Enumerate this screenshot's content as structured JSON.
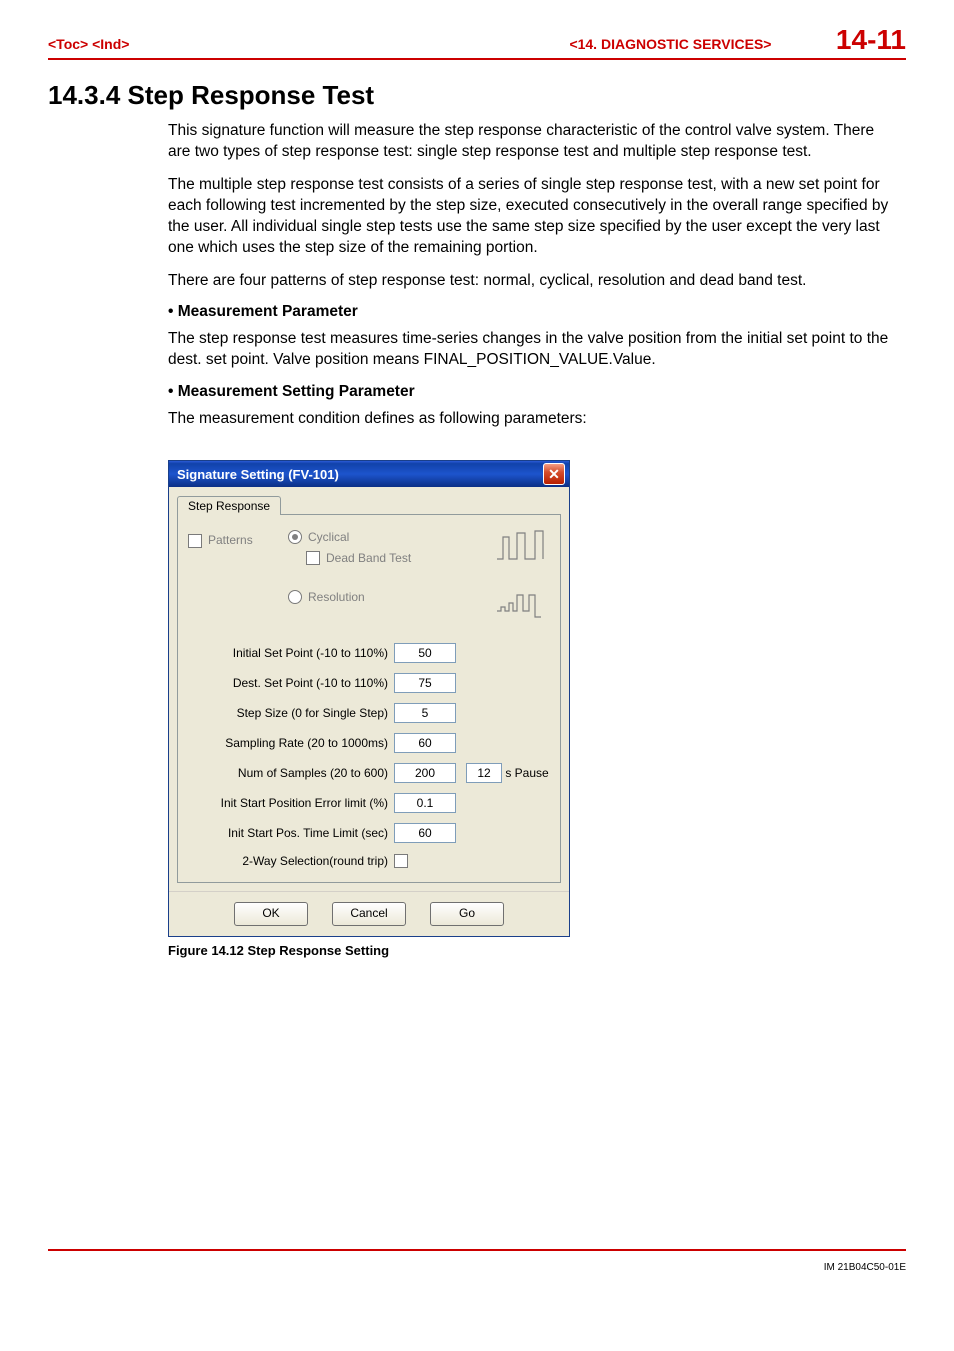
{
  "header": {
    "left": "<Toc> <Ind>",
    "chapter": "<14.  DIAGNOSTIC SERVICES>",
    "page": "14-11"
  },
  "section": {
    "number_title": "14.3.4  Step Response Test"
  },
  "paragraphs": {
    "p1": "This signature function will measure the step response characteristic of the control valve system. There are two types of step response test: single step response test and multiple step response test.",
    "p2": "The multiple step response test consists of a series of single step response test, with a new set point for each following test incremented by the step size, executed consecutively in the overall range specified by the user. All individual single step tests use the same step size specified by the user except the very last one which uses the step size of the remaining portion.",
    "p3": "There are four patterns of step response test: normal, cyclical, resolution and dead band test.",
    "bullet1": "Measurement Parameter",
    "p4": "The step response test measures time-series changes in the valve position from the initial set point to the dest. set point. Valve position means FINAL_POSITION_VALUE.Value.",
    "bullet2": "Measurement Setting Parameter",
    "p5": "The measurement condition defines as following parameters:"
  },
  "dialog": {
    "title": "Signature Setting (FV-101)",
    "tab": "Step Response",
    "patterns_label": "Patterns",
    "cyclical": "Cyclical",
    "dead_band": "Dead Band Test",
    "resolution": "Resolution",
    "fields": {
      "initial_set_point": {
        "label": "Initial Set Point (-10 to 110%)",
        "value": "50"
      },
      "dest_set_point": {
        "label": "Dest. Set Point (-10 to 110%)",
        "value": "75"
      },
      "step_size": {
        "label": "Step Size (0 for Single Step)",
        "value": "5"
      },
      "sampling_rate": {
        "label": "Sampling Rate (20 to 1000ms)",
        "value": "60"
      },
      "num_samples": {
        "label": "Num of Samples (20 to 600)",
        "value": "200",
        "pause_value": "12",
        "pause_suffix": "s  Pause"
      },
      "init_err_limit": {
        "label": "Init Start Position Error limit (%)",
        "value": "0.1"
      },
      "init_time_limit": {
        "label": "Init Start Pos. Time Limit (sec)",
        "value": "60"
      },
      "two_way": {
        "label": "2-Way Selection(round trip)"
      }
    },
    "buttons": {
      "ok": "OK",
      "cancel": "Cancel",
      "go": "Go"
    }
  },
  "figure_caption": "Figure 14.12  Step Response Setting",
  "footer_id": "IM 21B04C50-01E"
}
